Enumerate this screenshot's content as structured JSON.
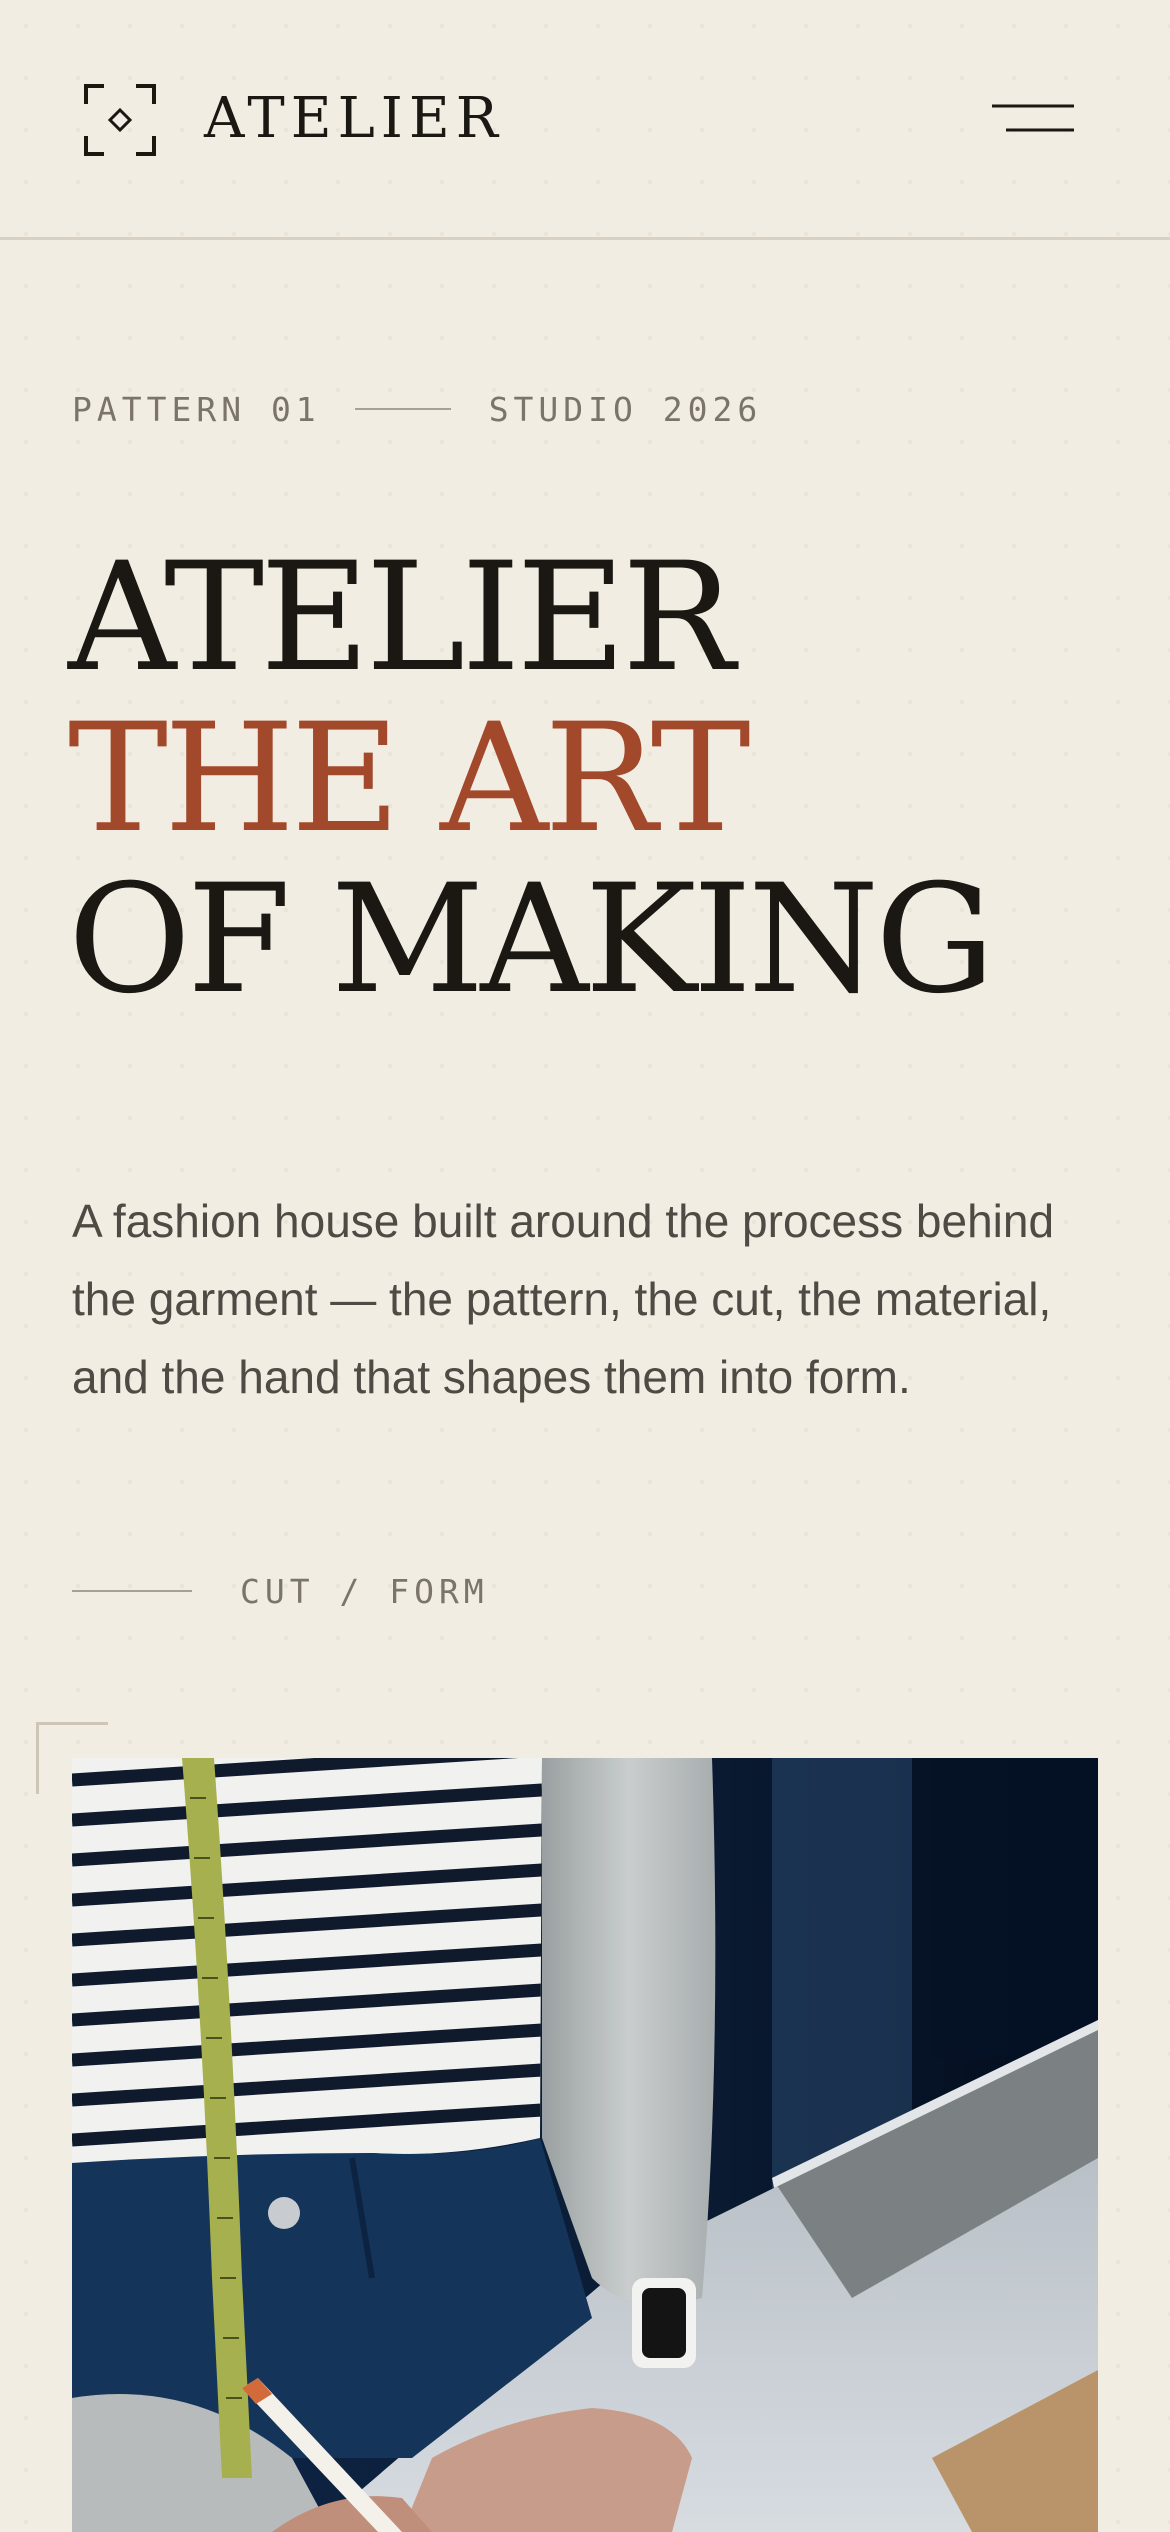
{
  "header": {
    "brand": "ATELIER",
    "logo_icon": "viewfinder-diamond-icon",
    "menu_icon": "hamburger-menu-icon"
  },
  "eyebrow": {
    "left": "PATTERN 01",
    "right": "STUDIO 2026"
  },
  "headline": {
    "line1": "ATELIER",
    "line2": "THE ART",
    "line3": "OF MAKING"
  },
  "description": "A fashion house built around the process behind the garment — the pattern, the cut, the material, and the hand that shapes them into form.",
  "tagline": "CUT / FORM",
  "hero_image": {
    "subject": "tailor-measuring-tape-photo"
  },
  "colors": {
    "background": "#f2ede3",
    "text": "#1b1813",
    "accent": "#a2482b",
    "muted": "#7b746a",
    "divider": "#d8d1c3"
  }
}
